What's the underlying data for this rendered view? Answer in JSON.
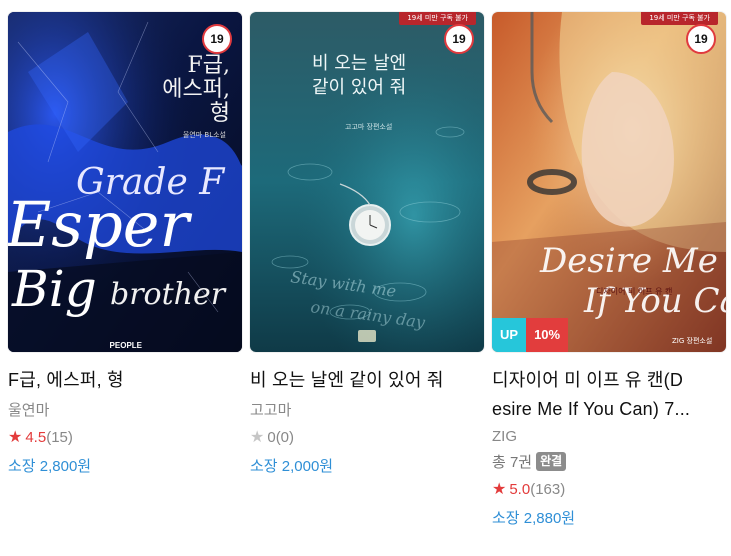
{
  "books": [
    {
      "cover": {
        "age_badge": "19",
        "title_ko_line1": "F급,",
        "title_ko_line2": "에스퍼,",
        "title_ko_line3": "형",
        "author_credit": "울연마 BL소설",
        "en_line1": "Grade F",
        "en_line2": "Esper",
        "en_line3": "Big",
        "en_line4": "brother",
        "publisher": "PEOPLE"
      },
      "title": "F급, 에스퍼, 형",
      "author": "울연마",
      "rating": "4.5",
      "review_count": "(15)",
      "price": "소장 2,800원"
    },
    {
      "cover": {
        "age_badge": "19",
        "age_banner": "19세 미만 구독 불가",
        "title_line1": "비 오는 날엔",
        "title_line2": "같이 있어 줘",
        "author_credit": "고고마 장편소설"
      },
      "title": "비 오는 날엔 같이 있어 줘",
      "author": "고고마",
      "rating": "0",
      "review_count": "(0)",
      "price": "소장 2,000원"
    },
    {
      "cover": {
        "age_badge": "19",
        "age_banner": "19세 미만 구독 불가",
        "script_line1": "Desire Me",
        "script_line2": "If You Can",
        "ko_subtitle": "디자이어 미 이프 유 캔",
        "credit": "ZIG 장편소설"
      },
      "title_line1": "디자이어 미 이프 유 캔(D",
      "title_line2": "esire Me If You Can) 7...",
      "author": "ZIG",
      "volumes": "총 7권",
      "status_badge": "완결",
      "badge_up": "UP",
      "badge_discount": "10%",
      "rating": "5.0",
      "review_count": "(163)",
      "price": "소장 2,880원"
    }
  ],
  "colors": {
    "rating_red": "#e33b3b",
    "price_blue": "#2f8fd6",
    "badge_cyan": "#26c6da",
    "badge_red": "#e23d3d"
  },
  "icons": [
    "star-icon"
  ]
}
